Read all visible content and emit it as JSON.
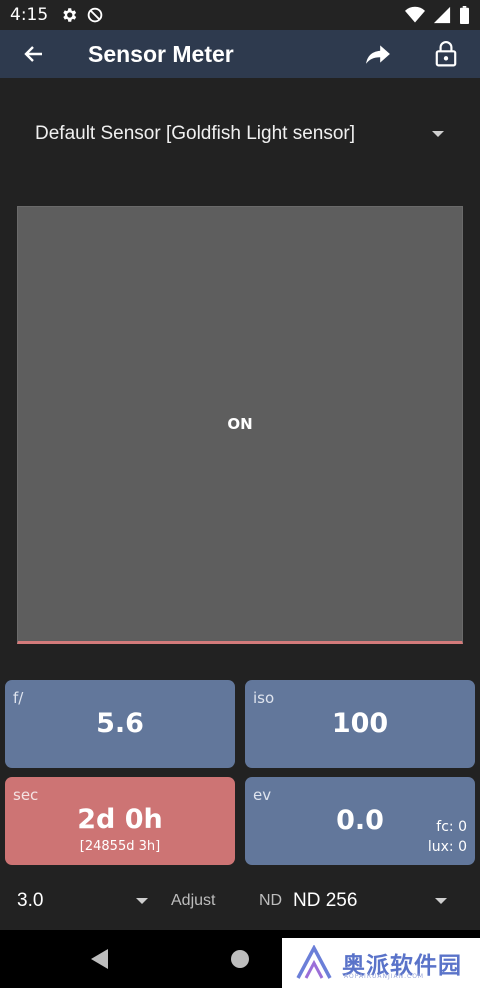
{
  "status_bar": {
    "time": "4:15",
    "icons": [
      "gear-icon",
      "do-not-disturb-icon",
      "wifi-icon",
      "signal-icon",
      "battery-icon"
    ]
  },
  "app_bar": {
    "title": "Sensor Meter",
    "back_icon": "back-arrow-icon",
    "actions": [
      "share-icon",
      "lock-open-icon"
    ]
  },
  "sensor_select": {
    "value": "Default Sensor [Goldfish Light sensor]"
  },
  "meter": {
    "state": "ON",
    "background": "#5e5e5e",
    "indicator_color": "#d47b7b"
  },
  "cards": {
    "aperture": {
      "label": "f/",
      "value": "5.6",
      "color": "#62779b"
    },
    "iso": {
      "label": "iso",
      "value": "100",
      "color": "#62779b"
    },
    "shutter": {
      "label": "sec",
      "value": "2d 0h",
      "sub": "[24855d 3h]",
      "color": "#cd7474"
    },
    "ev": {
      "label": "ev",
      "value": "0.0",
      "fc": "fc: 0",
      "lux": "lux: 0",
      "color": "#62779b"
    }
  },
  "bottom": {
    "adjust_value": "3.0",
    "adjust_label": "Adjust",
    "nd_label": "ND",
    "nd_value": "ND 256"
  },
  "nav": {
    "icons": [
      "back-triangle-icon",
      "home-circle-icon"
    ]
  },
  "watermark": {
    "text": "奥派软件园",
    "sub": "AOPAIRUANJIAN.COM"
  }
}
